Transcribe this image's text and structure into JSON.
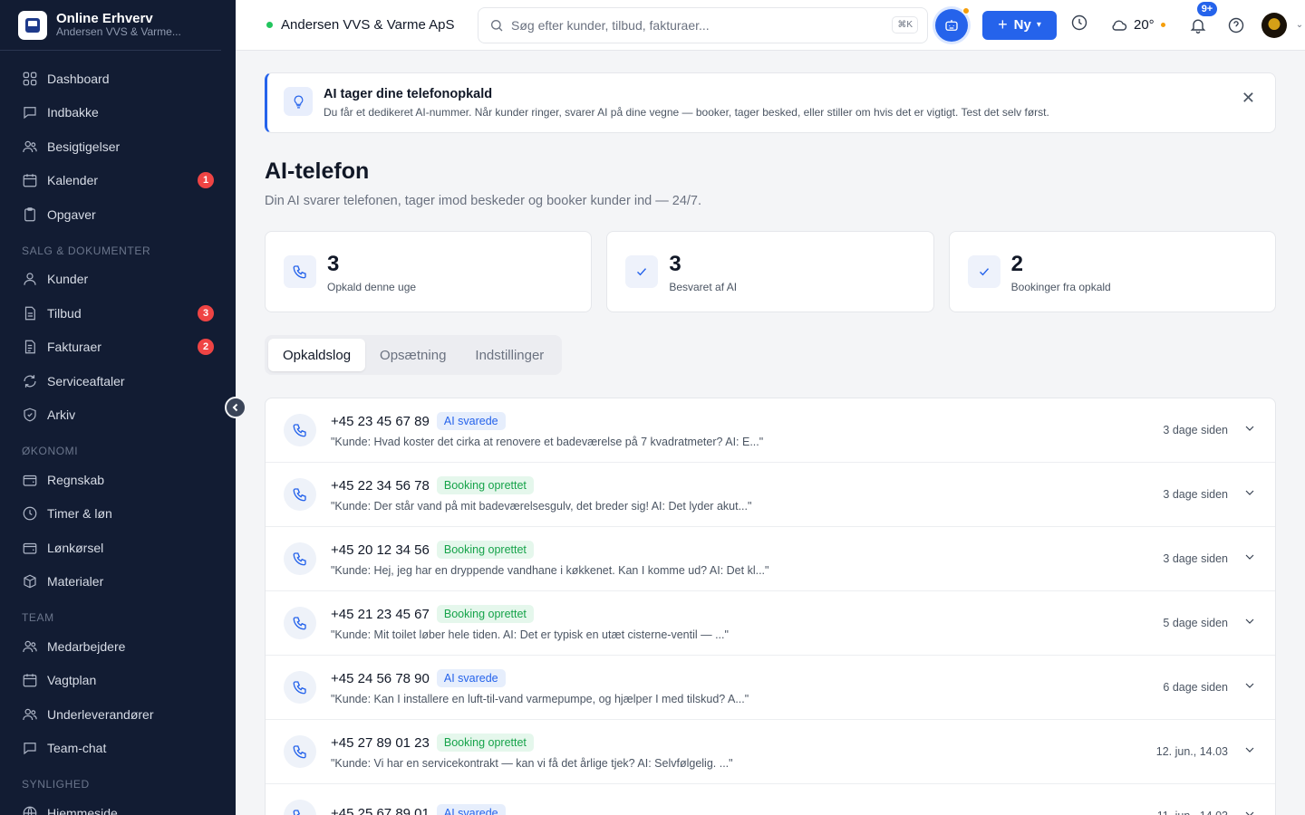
{
  "brand": {
    "title": "Online Erhverv",
    "subtitle": "Andersen VVS & Varme..."
  },
  "sidebar": {
    "main": [
      {
        "label": "Dashboard",
        "icon": "dashboard-icon"
      },
      {
        "label": "Indbakke",
        "icon": "chat-icon"
      },
      {
        "label": "Besigtigelser",
        "icon": "users-icon"
      },
      {
        "label": "Kalender",
        "icon": "calendar-icon",
        "badge": "1"
      },
      {
        "label": "Opgaver",
        "icon": "clipboard-icon"
      }
    ],
    "section_sales": "SALG & DOKUMENTER",
    "sales": [
      {
        "label": "Kunder",
        "icon": "user-icon"
      },
      {
        "label": "Tilbud",
        "icon": "document-icon",
        "badge": "3"
      },
      {
        "label": "Fakturaer",
        "icon": "invoice-icon",
        "badge": "2"
      },
      {
        "label": "Serviceaftaler",
        "icon": "refresh-icon"
      },
      {
        "label": "Arkiv",
        "icon": "shield-icon"
      }
    ],
    "section_economy": "ØKONOMI",
    "economy": [
      {
        "label": "Regnskab",
        "icon": "wallet-icon"
      },
      {
        "label": "Timer & løn",
        "icon": "clock-icon"
      },
      {
        "label": "Lønkørsel",
        "icon": "wallet-icon"
      },
      {
        "label": "Materialer",
        "icon": "box-icon"
      }
    ],
    "section_team": "TEAM",
    "team": [
      {
        "label": "Medarbejdere",
        "icon": "users-icon"
      },
      {
        "label": "Vagtplan",
        "icon": "calendar-icon"
      },
      {
        "label": "Underleverandører",
        "icon": "users-icon"
      },
      {
        "label": "Team-chat",
        "icon": "chat-icon"
      }
    ],
    "section_visibility": "SYNLIGHED",
    "visibility": [
      {
        "label": "Hjemmeside",
        "icon": "globe-icon"
      }
    ]
  },
  "header": {
    "company": "Andersen VVS & Varme ApS",
    "search_placeholder": "Søg efter kunder, tilbud, fakturaer...",
    "search_shortcut": "⌘K",
    "new_label": "Ny",
    "temperature": "20°",
    "notifications": "9+"
  },
  "banner": {
    "title": "AI tager dine telefonopkald",
    "text": "Du får et dedikeret AI-nummer. Når kunder ringer, svarer AI på dine vegne — booker, tager besked, eller stiller om hvis det er vigtigt. Test det selv først."
  },
  "page": {
    "title": "AI-telefon",
    "subtitle": "Din AI svarer telefonen, tager imod beskeder og booker kunder ind — 24/7."
  },
  "stats": [
    {
      "value": "3",
      "label": "Opkald denne uge",
      "icon": "phone-icon"
    },
    {
      "value": "3",
      "label": "Besvaret af AI",
      "icon": "check-icon"
    },
    {
      "value": "2",
      "label": "Bookinger fra opkald",
      "icon": "check-icon"
    }
  ],
  "tabs": [
    "Opkaldslog",
    "Opsætning",
    "Indstillinger"
  ],
  "calls": [
    {
      "number": "+45 23 45 67 89",
      "status": "AI svarede",
      "type": "ai",
      "snippet": "\"Kunde: Hvad koster det cirka at renovere et badeværelse på 7 kvadratmeter? AI: E...\"",
      "time": "3 dage siden"
    },
    {
      "number": "+45 22 34 56 78",
      "status": "Booking oprettet",
      "type": "book",
      "snippet": "\"Kunde: Der står vand på mit badeværelsesgulv, det breder sig! AI: Det lyder akut...\"",
      "time": "3 dage siden"
    },
    {
      "number": "+45 20 12 34 56",
      "status": "Booking oprettet",
      "type": "book",
      "snippet": "\"Kunde: Hej, jeg har en dryppende vandhane i køkkenet. Kan I komme ud? AI: Det kl...\"",
      "time": "3 dage siden"
    },
    {
      "number": "+45 21 23 45 67",
      "status": "Booking oprettet",
      "type": "book",
      "snippet": "\"Kunde: Mit toilet løber hele tiden. AI: Det er typisk en utæt cisterne-ventil — ...\"",
      "time": "5 dage siden"
    },
    {
      "number": "+45 24 56 78 90",
      "status": "AI svarede",
      "type": "ai",
      "snippet": "\"Kunde: Kan I installere en luft-til-vand varmepumpe, og hjælper I med tilskud? A...\"",
      "time": "6 dage siden"
    },
    {
      "number": "+45 27 89 01 23",
      "status": "Booking oprettet",
      "type": "book",
      "snippet": "\"Kunde: Vi har en servicekontrakt — kan vi få det årlige tjek? AI: Selvfølgelig. ...\"",
      "time": "12. jun., 14.03"
    },
    {
      "number": "+45 25 67 89 01",
      "status": "AI svarede",
      "type": "ai",
      "snippet": "",
      "time": "11. jun., 14.03"
    }
  ]
}
